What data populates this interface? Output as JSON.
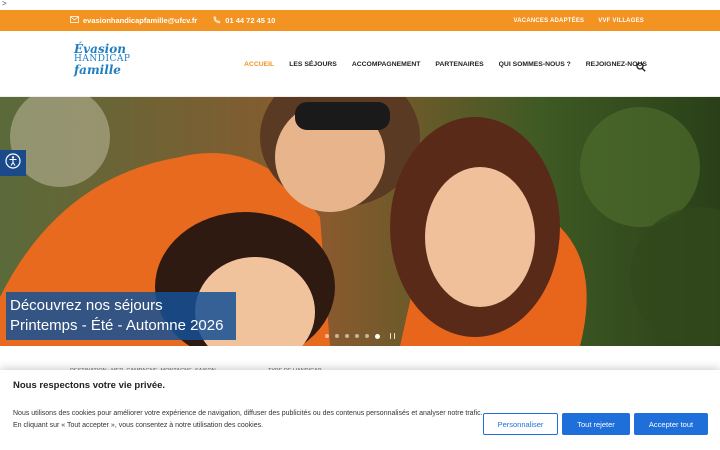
{
  "topline": ">",
  "topbar": {
    "email": "evasionhandicapfamille@ufcv.fr",
    "phone": "01 44 72 45 10",
    "links": [
      "VACANCES ADAPTÉES",
      "VVF VILLAGES"
    ],
    "color": "#f39322"
  },
  "logo": {
    "line1": "Évasion",
    "line2": "HANDICAP",
    "line3": "famille"
  },
  "nav": {
    "items": [
      "ACCUEIL",
      "LES SÉJOURS",
      "ACCOMPAGNEMENT",
      "PARTENAIRES",
      "QUI SOMMES-NOUS ?",
      "REJOIGNEZ-NOUS"
    ],
    "active_index": 0
  },
  "hero": {
    "caption_line1": "Découvrez nos séjours",
    "caption_line2": "Printemps - Été - Automne 2026",
    "slides": 6,
    "active_slide": 5
  },
  "filters": {
    "destination": "DESTINATION : MER, CAMPAGNE, MONTAGNE, SAISON",
    "handicap": "TYPE DE HANDICAP"
  },
  "cookie": {
    "title": "Nous respectons votre vie privée.",
    "text": "Nous utilisons des cookies pour améliorer votre expérience de navigation, diffuser des publicités ou des contenus personnalisés et analyser notre trafic. En cliquant sur « Tout accepter », vous consentez à notre utilisation des cookies.",
    "customize": "Personnaliser",
    "reject": "Tout rejeter",
    "accept": "Accepter tout",
    "button_color": "#1e6fd9"
  }
}
